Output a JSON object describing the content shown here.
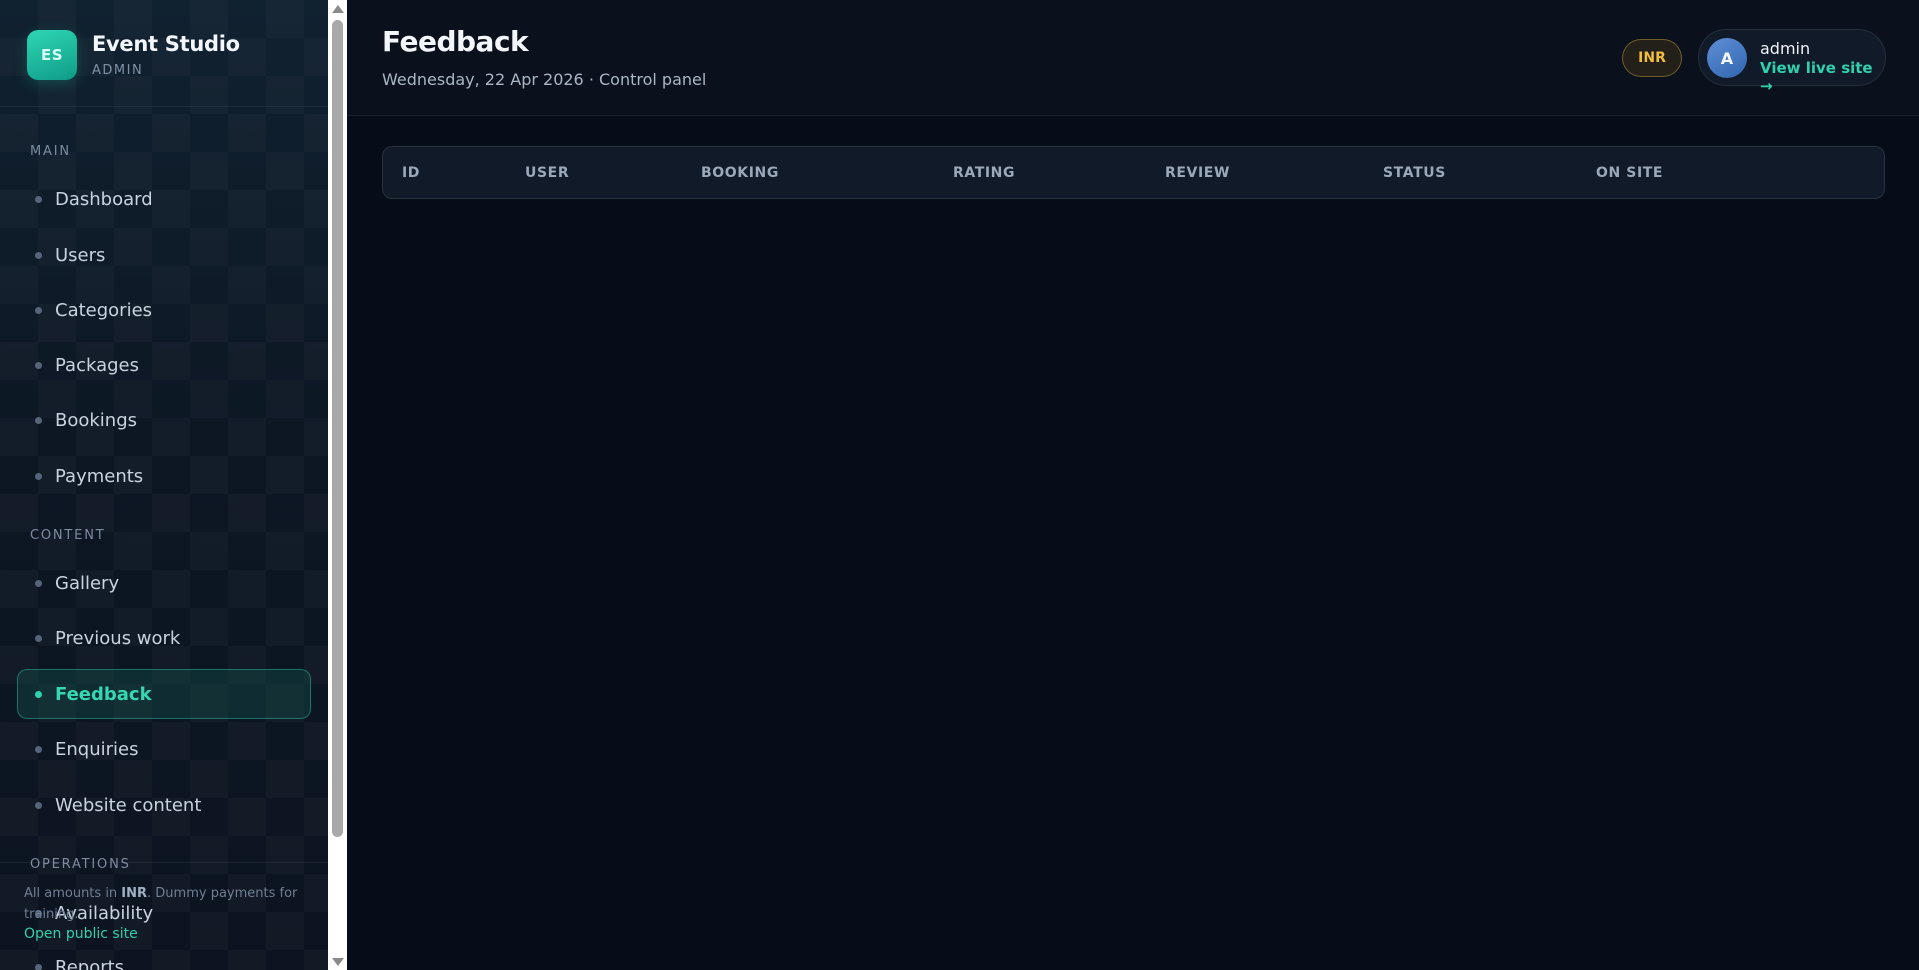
{
  "brand": {
    "logo": "ES",
    "name": "Event Studio",
    "subtitle": "ADMIN"
  },
  "sidebar": {
    "sections": [
      {
        "title": "MAIN"
      },
      {
        "title": "CONTENT"
      },
      {
        "title": "OPERATIONS"
      }
    ],
    "items": [
      {
        "label": "Dashboard"
      },
      {
        "label": "Users"
      },
      {
        "label": "Categories"
      },
      {
        "label": "Packages"
      },
      {
        "label": "Bookings"
      },
      {
        "label": "Payments"
      },
      {
        "label": "Gallery"
      },
      {
        "label": "Previous work"
      },
      {
        "label": "Feedback",
        "active": true
      },
      {
        "label": "Enquiries"
      },
      {
        "label": "Website content"
      },
      {
        "label": "Availability"
      },
      {
        "label": "Reports"
      }
    ],
    "footer": {
      "note_prefix": "All amounts in ",
      "note_currency": "INR",
      "note_suffix": ". Dummy payments for training.",
      "link": "Open public site"
    }
  },
  "header": {
    "title": "Feedback",
    "subtitle": "Wednesday, 22 Apr 2026 · Control panel",
    "currency": "INR",
    "user": {
      "avatar": "A",
      "name": "admin",
      "link": "View live site →"
    }
  },
  "table": {
    "columns": [
      "ID",
      "USER",
      "BOOKING",
      "RATING",
      "REVIEW",
      "STATUS",
      "ON SITE"
    ],
    "rows": []
  },
  "colors": {
    "accent": "#2fd1ad",
    "currency_badge": "#f0bd3c",
    "background": "#070d18"
  },
  "icons": {
    "nav_bullet": "dot-icon",
    "scroll_up": "triangle-up-icon",
    "scroll_down": "triangle-down-icon"
  }
}
